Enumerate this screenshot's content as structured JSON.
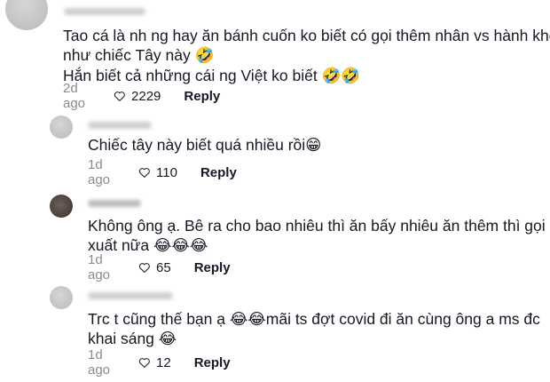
{
  "comments": [
    {
      "lines": [
        "Tao cá là nh ng hay ăn bánh cuốn ko biết có gọi thêm nhân vs hành khô",
        "như chiếc Tây này 🤣",
        "Hắn biết cả những cái ng Việt ko biết 🤣🤣"
      ],
      "time": "2d ago",
      "likes": "2229",
      "reply": "Reply"
    },
    {
      "lines": [
        "Chiếc tây này biết quá nhiều rồi😁"
      ],
      "time": "1d ago",
      "likes": "110",
      "reply": "Reply"
    },
    {
      "lines": [
        "Không ông ạ. Bê ra cho bao nhiêu thì ăn bấy nhiêu ăn thêm thì gọi",
        "xuất nữa 😂😂😂"
      ],
      "time": "1d ago",
      "likes": "65",
      "reply": "Reply"
    },
    {
      "lines": [
        "Trc t cũng thế bạn ạ 😂😂mãi ts đợt covid đi ăn cùng ông a ms đc",
        "khai sáng 😂"
      ],
      "time": "1d ago",
      "likes": "12",
      "reply": "Reply"
    }
  ],
  "icons": {
    "like": "heart-outline-icon"
  }
}
